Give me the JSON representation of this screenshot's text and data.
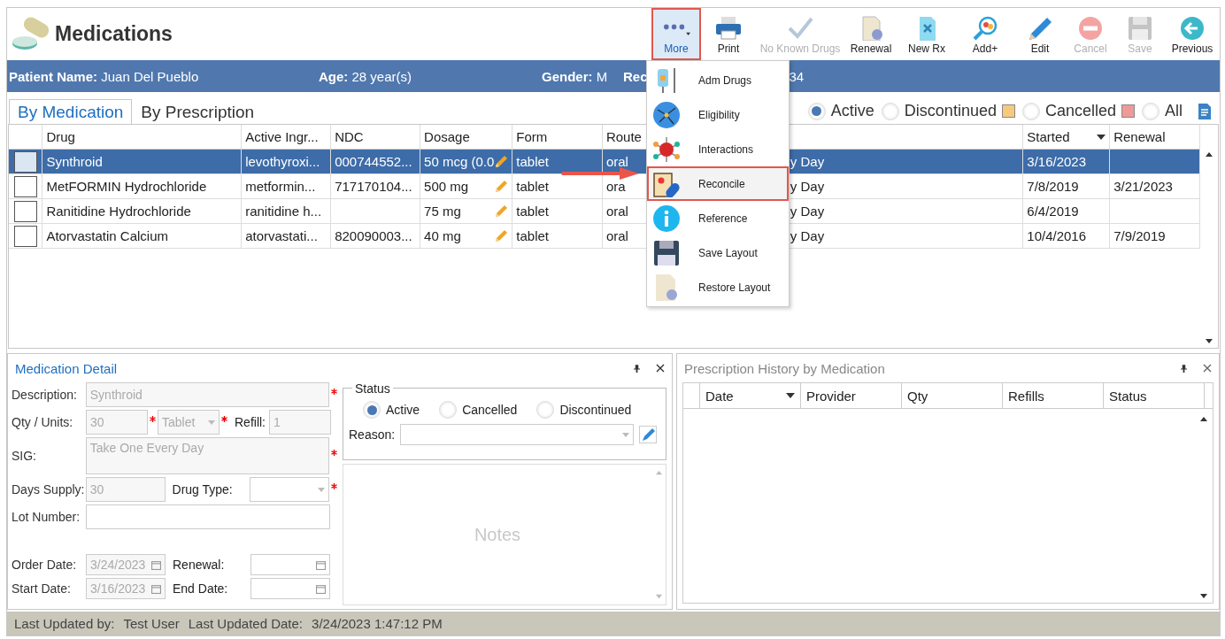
{
  "window": {
    "title": "Medications"
  },
  "toolbar": [
    {
      "kind": "more",
      "label": "More",
      "disabled": false,
      "selected": true
    },
    {
      "kind": "print",
      "label": "Print",
      "disabled": false,
      "selected": false
    },
    {
      "kind": "check",
      "label": "No Known Drugs",
      "disabled": true,
      "selected": false
    },
    {
      "kind": "renewal",
      "label": "Renewal",
      "disabled": false,
      "selected": false
    },
    {
      "kind": "newrx",
      "label": "New Rx",
      "disabled": false,
      "selected": false
    },
    {
      "kind": "add",
      "label": "Add+",
      "disabled": false,
      "selected": false
    },
    {
      "kind": "edit",
      "label": "Edit",
      "disabled": false,
      "selected": false
    },
    {
      "kind": "cancel",
      "label": "Cancel",
      "disabled": true,
      "selected": false
    },
    {
      "kind": "save",
      "label": "Save",
      "disabled": true,
      "selected": false
    },
    {
      "kind": "previous",
      "label": "Previous",
      "disabled": false,
      "selected": false
    }
  ],
  "patient_bar": [
    {
      "label": "Patient Name:",
      "value": "Juan Del Pueblo"
    },
    {
      "label": "Age:",
      "value": "28 year(s)"
    },
    {
      "label": "Gender:",
      "value": "M"
    },
    {
      "label": "Rec"
    },
    {
      "value": "34"
    }
  ],
  "tabs": [
    {
      "label": "By Medication",
      "selected": true
    },
    {
      "label": "By Prescription",
      "selected": false
    }
  ],
  "filters": [
    {
      "label": "Active",
      "selected": true
    },
    {
      "label": "Discontinued",
      "selected": false,
      "color": "#f7c97e"
    },
    {
      "label": "Cancelled",
      "selected": false,
      "color": "#ef9a9a"
    },
    {
      "label": "All",
      "selected": false
    }
  ],
  "table": {
    "columns": [
      {
        "label": "Drug",
        "sorted": false
      },
      {
        "label": "Active Ingr...",
        "sorted": false
      },
      {
        "label": "NDC",
        "sorted": false
      },
      {
        "label": "Dosage",
        "sorted": false
      },
      {
        "label": "Form",
        "sorted": false
      },
      {
        "label": "Route",
        "sorted": false
      },
      {
        "label": "Started",
        "sorted": true
      },
      {
        "label": "Renewal",
        "sorted": false
      }
    ],
    "rows": [
      {
        "selected": true,
        "checked": false,
        "drug": "Synthroid",
        "active_ingredient": "levothyroxi...",
        "ndc": "000744552...",
        "dosage": "50 mcg (0.0",
        "form": "tablet",
        "route": "oral",
        "column_7": "y Day",
        "started": "3/16/2023"
      },
      {
        "selected": false,
        "checked": false,
        "drug": "MetFORMIN Hydrochloride",
        "active_ingredient": "metformin...",
        "ndc": "717170104...",
        "dosage": "500 mg",
        "form": "tablet",
        "route": "ora",
        "column_7": "y Day",
        "started": "7/8/2019",
        "renewal": "3/21/2023"
      },
      {
        "selected": false,
        "checked": false,
        "drug": "Ranitidine Hydrochloride",
        "active_ingredient": "ranitidine h...",
        "dosage": "75 mg",
        "form": "tablet",
        "route": "oral",
        "column_7": "y Day",
        "started": "6/4/2019"
      },
      {
        "selected": false,
        "checked": false,
        "drug": "Atorvastatin Calcium",
        "active_ingredient": "atorvastati...",
        "ndc": "820090003...",
        "dosage": "40 mg",
        "form": "tablet",
        "route": "oral",
        "column_7": "y Day",
        "started": "10/4/2016",
        "renewal": "7/9/2019"
      }
    ]
  },
  "more_menu": [
    {
      "kind": "iv",
      "label": "Adm Drugs",
      "selected": false
    },
    {
      "kind": "globe",
      "label": "Eligibility",
      "selected": false
    },
    {
      "kind": "molecule",
      "label": "Interactions",
      "selected": false
    },
    {
      "kind": "clipboard",
      "label": "Reconcile",
      "selected": true
    },
    {
      "kind": "info",
      "label": "Reference",
      "selected": false
    },
    {
      "kind": "floppy",
      "label": "Save Layout",
      "selected": false
    },
    {
      "kind": "document",
      "label": "Restore Layout",
      "selected": false
    }
  ],
  "medication_detail": {
    "title": "Medication Detail",
    "description": {
      "label": "Description:",
      "value": "Synthroid",
      "required": true,
      "disabled": true
    },
    "qty": {
      "label": "Qty / Units:",
      "value": "30",
      "required": true,
      "disabled": true
    },
    "units": {
      "value": "Tablet",
      "required": true,
      "disabled": true
    },
    "refill": {
      "label": "Refill:",
      "value": "1",
      "disabled": true
    },
    "sig": {
      "label": "SIG:",
      "value": "Take One Every Day",
      "required": true,
      "disabled": true
    },
    "days_supply": {
      "label": "Days Supply:",
      "value": "30",
      "disabled": true
    },
    "drug_type": {
      "label": "Drug Type:",
      "required": true
    },
    "lot_number": {
      "label": "Lot Number:"
    },
    "order_date": {
      "label": "Order Date:",
      "value": "3/24/2023",
      "disabled": true
    },
    "renewal": {
      "label": "Renewal:"
    },
    "start_date": {
      "label": "Start Date:",
      "value": "3/16/2023",
      "disabled": true
    },
    "end_date": {
      "label": "End Date:"
    },
    "status": {
      "title": "Status",
      "options": [
        {
          "label": "Active",
          "selected": true
        },
        {
          "label": "Cancelled",
          "selected": false
        },
        {
          "label": "Discontinued",
          "selected": false
        }
      ],
      "reason": {
        "label": "Reason:"
      }
    },
    "notes": {
      "placeholder": "Notes"
    }
  },
  "prescription_history": {
    "title": "Prescription History by Medication",
    "columns": [
      {
        "label": "Date",
        "sorted": true
      },
      {
        "label": "Provider",
        "sorted": false
      },
      {
        "label": "Qty",
        "sorted": false
      },
      {
        "label": "Refills",
        "sorted": false
      },
      {
        "label": "Status",
        "sorted": false
      }
    ]
  },
  "status_bar": [
    {
      "label": "Last Updated by:",
      "value": "Test User"
    },
    {
      "label": "Last Updated Date:",
      "value": "3/24/2023 1:47:12 PM"
    }
  ]
}
